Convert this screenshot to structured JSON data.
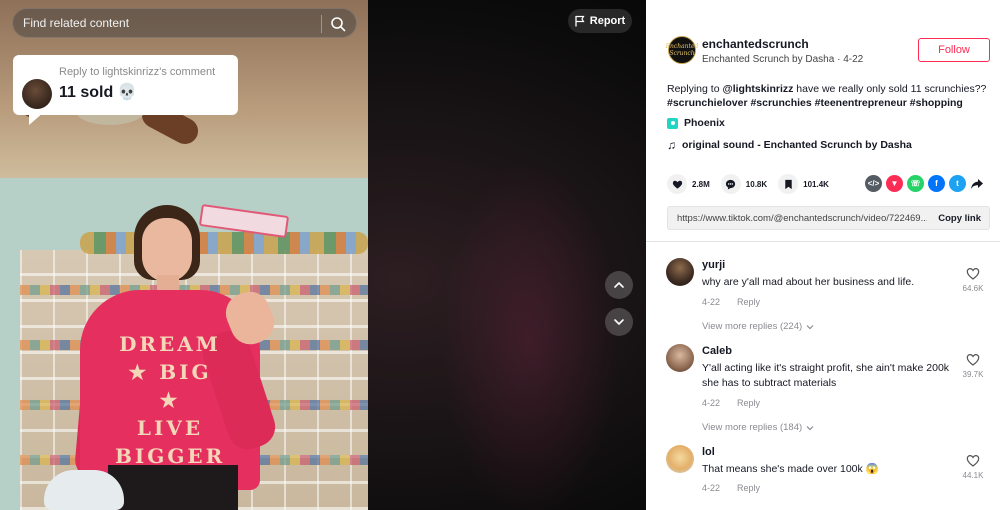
{
  "search": {
    "placeholder": "Find related content"
  },
  "video": {
    "reply_sticker": {
      "header": "Reply to lightskinrizz's comment",
      "text": "11 sold",
      "emoji": "💀"
    },
    "shirt_lines": [
      "DREAM",
      "★ BIG ★",
      "LIVE",
      "BIGGER"
    ],
    "report_label": "Report",
    "nav_up_icon": "chevron-up-icon",
    "nav_down_icon": "chevron-down-icon"
  },
  "post": {
    "author": {
      "username": "enchantedscrunch",
      "subtitle": "Enchanted Scrunch by Dasha · 4-22",
      "avatar_text": "Enchanted Scrunch"
    },
    "follow_label": "Follow",
    "caption": {
      "prefix": "Replying to ",
      "mention": "@lightskinrizz",
      "body": " have we really only sold 11 scrunchies??",
      "hashtags": "#scrunchielover #scrunchies #teenentrepreneur #shopping"
    },
    "location": "Phoenix",
    "sound": "original sound - Enchanted Scrunch by Dasha",
    "stats": {
      "likes": "2.8M",
      "comments": "10.8K",
      "saves": "101.4K"
    },
    "share_icons": [
      "embed-icon",
      "send-icon",
      "whatsapp-icon",
      "facebook-icon",
      "twitter-icon",
      "share-arrow-icon"
    ],
    "link": {
      "url": "https://www.tiktok.com/@enchantedscrunch/video/722469...",
      "copy_label": "Copy link"
    }
  },
  "comments": [
    {
      "name": "yurji",
      "text": "why are y'all mad about her business and life.",
      "date": "4-22",
      "reply": "Reply",
      "likes": "64.6K",
      "more": "View more replies (224)"
    },
    {
      "name": "Caleb",
      "text": "Y'all acting like it's straight profit, she ain't make 200k she has to subtract materials",
      "date": "4-22",
      "reply": "Reply",
      "likes": "39.7K",
      "more": "View more replies (184)"
    },
    {
      "name": "lol",
      "text": "That means she's made over 100k 😱",
      "date": "4-22",
      "reply": "Reply",
      "likes": "44.1K"
    }
  ],
  "colors": {
    "accent": "#fe2c55",
    "location": "#20d5c4",
    "text": "#161823",
    "muted": "#8a8b91"
  }
}
